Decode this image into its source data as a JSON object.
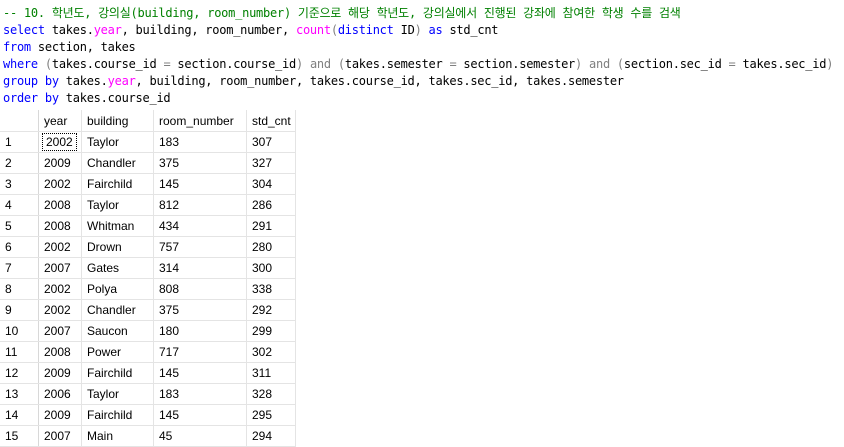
{
  "query_lines": [
    [
      {
        "t": "-- 10. 학년도, 강의실(building, room_number) 기준으로 해당 학년도, 강의실에서 진행된 강좌에 참여한 학생 수를 검색",
        "c": "cm"
      }
    ],
    [
      {
        "t": "select",
        "c": "kw"
      },
      {
        "t": " takes.",
        "c": "tx"
      },
      {
        "t": "year",
        "c": "fn"
      },
      {
        "t": ", building, room_number, ",
        "c": "tx"
      },
      {
        "t": "count",
        "c": "fn"
      },
      {
        "t": "(",
        "c": "op"
      },
      {
        "t": "distinct",
        "c": "kw"
      },
      {
        "t": " ID",
        "c": "tx"
      },
      {
        "t": ")",
        "c": "op"
      },
      {
        "t": " ",
        "c": "tx"
      },
      {
        "t": "as",
        "c": "kw"
      },
      {
        "t": " std_cnt",
        "c": "tx"
      }
    ],
    [
      {
        "t": "from",
        "c": "kw"
      },
      {
        "t": " section, takes",
        "c": "tx"
      }
    ],
    [
      {
        "t": "where",
        "c": "kw"
      },
      {
        "t": " ",
        "c": "tx"
      },
      {
        "t": "(",
        "c": "op"
      },
      {
        "t": "takes.course_id ",
        "c": "tx"
      },
      {
        "t": "=",
        "c": "op"
      },
      {
        "t": " section.course_id",
        "c": "tx"
      },
      {
        "t": ")",
        "c": "op"
      },
      {
        "t": " ",
        "c": "tx"
      },
      {
        "t": "and",
        "c": "op"
      },
      {
        "t": " ",
        "c": "tx"
      },
      {
        "t": "(",
        "c": "op"
      },
      {
        "t": "takes.semester ",
        "c": "tx"
      },
      {
        "t": "=",
        "c": "op"
      },
      {
        "t": " section.semester",
        "c": "tx"
      },
      {
        "t": ")",
        "c": "op"
      },
      {
        "t": " ",
        "c": "tx"
      },
      {
        "t": "and",
        "c": "op"
      },
      {
        "t": " ",
        "c": "tx"
      },
      {
        "t": "(",
        "c": "op"
      },
      {
        "t": "section.sec_id ",
        "c": "tx"
      },
      {
        "t": "=",
        "c": "op"
      },
      {
        "t": " takes.sec_id",
        "c": "tx"
      },
      {
        "t": ")",
        "c": "op"
      }
    ],
    [
      {
        "t": "group",
        "c": "kw"
      },
      {
        "t": " ",
        "c": "tx"
      },
      {
        "t": "by",
        "c": "kw"
      },
      {
        "t": " takes.",
        "c": "tx"
      },
      {
        "t": "year",
        "c": "fn"
      },
      {
        "t": ", building, room_number, takes.course_id, takes.sec_id, takes.semester",
        "c": "tx"
      }
    ],
    [
      {
        "t": "order",
        "c": "kw"
      },
      {
        "t": " ",
        "c": "tx"
      },
      {
        "t": "by",
        "c": "kw"
      },
      {
        "t": " takes.course_id",
        "c": "tx"
      }
    ]
  ],
  "results": {
    "columns": [
      "year",
      "building",
      "room_number",
      "std_cnt"
    ],
    "rows": [
      [
        "1",
        "2002",
        "Taylor",
        "183",
        "307"
      ],
      [
        "2",
        "2009",
        "Chandler",
        "375",
        "327"
      ],
      [
        "3",
        "2002",
        "Fairchild",
        "145",
        "304"
      ],
      [
        "4",
        "2008",
        "Taylor",
        "812",
        "286"
      ],
      [
        "5",
        "2008",
        "Whitman",
        "434",
        "291"
      ],
      [
        "6",
        "2002",
        "Drown",
        "757",
        "280"
      ],
      [
        "7",
        "2007",
        "Gates",
        "314",
        "300"
      ],
      [
        "8",
        "2002",
        "Polya",
        "808",
        "338"
      ],
      [
        "9",
        "2002",
        "Chandler",
        "375",
        "292"
      ],
      [
        "10",
        "2007",
        "Saucon",
        "180",
        "299"
      ],
      [
        "11",
        "2008",
        "Power",
        "717",
        "302"
      ],
      [
        "12",
        "2009",
        "Fairchild",
        "145",
        "311"
      ],
      [
        "13",
        "2006",
        "Taylor",
        "183",
        "328"
      ],
      [
        "14",
        "2009",
        "Fairchild",
        "145",
        "295"
      ],
      [
        "15",
        "2007",
        "Main",
        "45",
        "294"
      ]
    ]
  }
}
